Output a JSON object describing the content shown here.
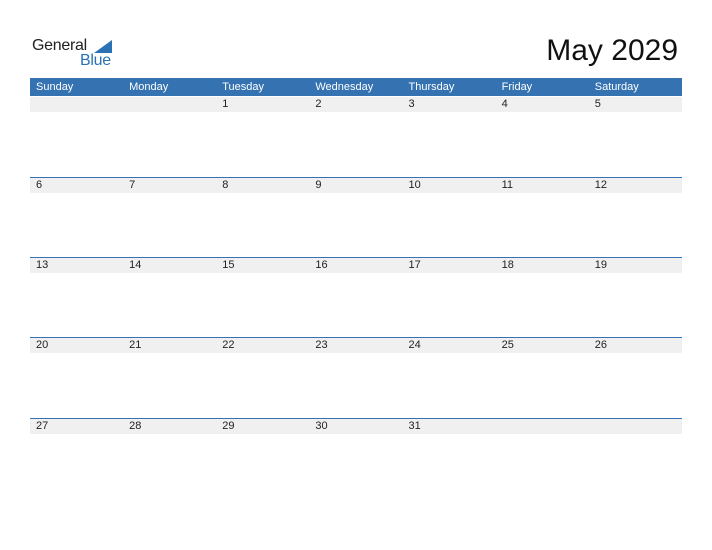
{
  "logo": {
    "general": "General",
    "blue": "Blue"
  },
  "title": "May 2029",
  "weekdays": [
    "Sunday",
    "Monday",
    "Tuesday",
    "Wednesday",
    "Thursday",
    "Friday",
    "Saturday"
  ],
  "weeks": [
    [
      "",
      "",
      "1",
      "2",
      "3",
      "4",
      "5"
    ],
    [
      "6",
      "7",
      "8",
      "9",
      "10",
      "11",
      "12"
    ],
    [
      "13",
      "14",
      "15",
      "16",
      "17",
      "18",
      "19"
    ],
    [
      "20",
      "21",
      "22",
      "23",
      "24",
      "25",
      "26"
    ],
    [
      "27",
      "28",
      "29",
      "30",
      "31",
      "",
      ""
    ]
  ],
  "colors": {
    "accent": "#3572b1",
    "strip": "#f0f0f0"
  }
}
